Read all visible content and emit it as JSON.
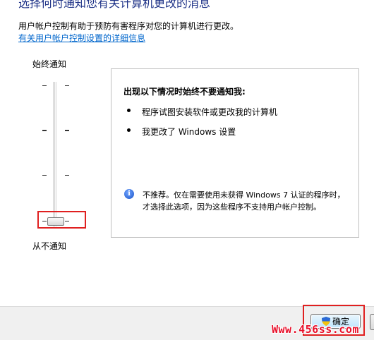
{
  "header": {
    "title": "选择何时通知您有关计算机更改的消息",
    "description": "用户帐户控制有助于预防有害程序对您的计算机进行更改。",
    "settings_link": "有关用户帐户控制设置的详细信息"
  },
  "slider": {
    "top_label": "始终通知",
    "bottom_label": "从不通知",
    "level_index": 3,
    "level_count": 4
  },
  "panel": {
    "title": "出现以下情况时始终不要通知我:",
    "bullets": [
      "程序试图安装软件或更改我的计算机",
      "我更改了 Windows 设置"
    ],
    "info_text": "不推荐。仅在需要使用未获得 Windows 7 认证的程序时，才选择此选项，因为这些程序不支持用户帐户控制。"
  },
  "footer": {
    "ok_label": "确定"
  },
  "watermark": "Www.456ss.com",
  "colors": {
    "heading": "#1e3287",
    "link": "#0066cc",
    "highlight_box": "#e02020"
  }
}
